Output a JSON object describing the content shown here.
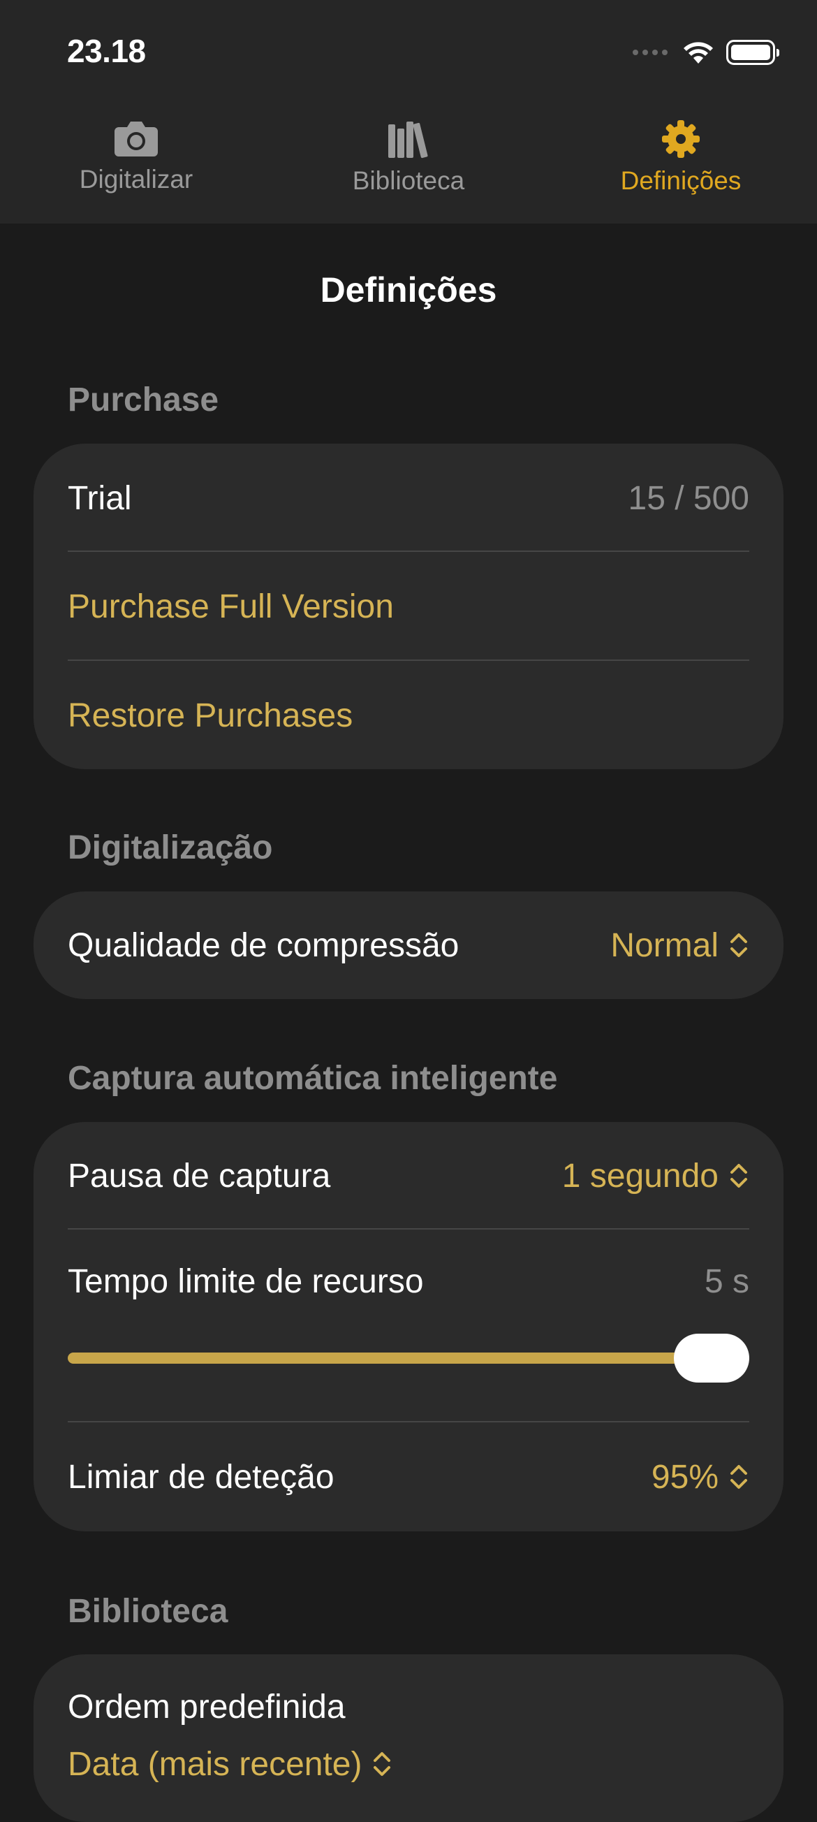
{
  "status": {
    "time": "23.18"
  },
  "tabs": [
    {
      "label": "Digitalizar",
      "icon": "camera-icon",
      "active": false
    },
    {
      "label": "Biblioteca",
      "icon": "library-icon",
      "active": false
    },
    {
      "label": "Definições",
      "icon": "gear-icon",
      "active": true
    }
  ],
  "page": {
    "title": "Definições"
  },
  "purchase": {
    "header": "Purchase",
    "trial_label": "Trial",
    "trial_value": "15 / 500",
    "full_version": "Purchase Full Version",
    "restore": "Restore Purchases"
  },
  "scanning": {
    "header": "Digitalização",
    "compression_label": "Qualidade de compressão",
    "compression_value": "Normal"
  },
  "smart_capture": {
    "header": "Captura automática inteligente",
    "pause_label": "Pausa de captura",
    "pause_value": "1 segundo",
    "timeout_label": "Tempo limite de recurso",
    "timeout_value": "5 s",
    "timeout_slider_fraction": 1.0,
    "threshold_label": "Limiar de deteção",
    "threshold_value": "95%"
  },
  "library": {
    "header": "Biblioteca",
    "order_label": "Ordem predefinida",
    "order_value": "Data (mais recente)"
  },
  "colors": {
    "accent": "#e0a820",
    "accent_text": "#d6b455",
    "background": "#1b1b1b",
    "card": "#2b2b2b",
    "topbar": "#262626"
  }
}
